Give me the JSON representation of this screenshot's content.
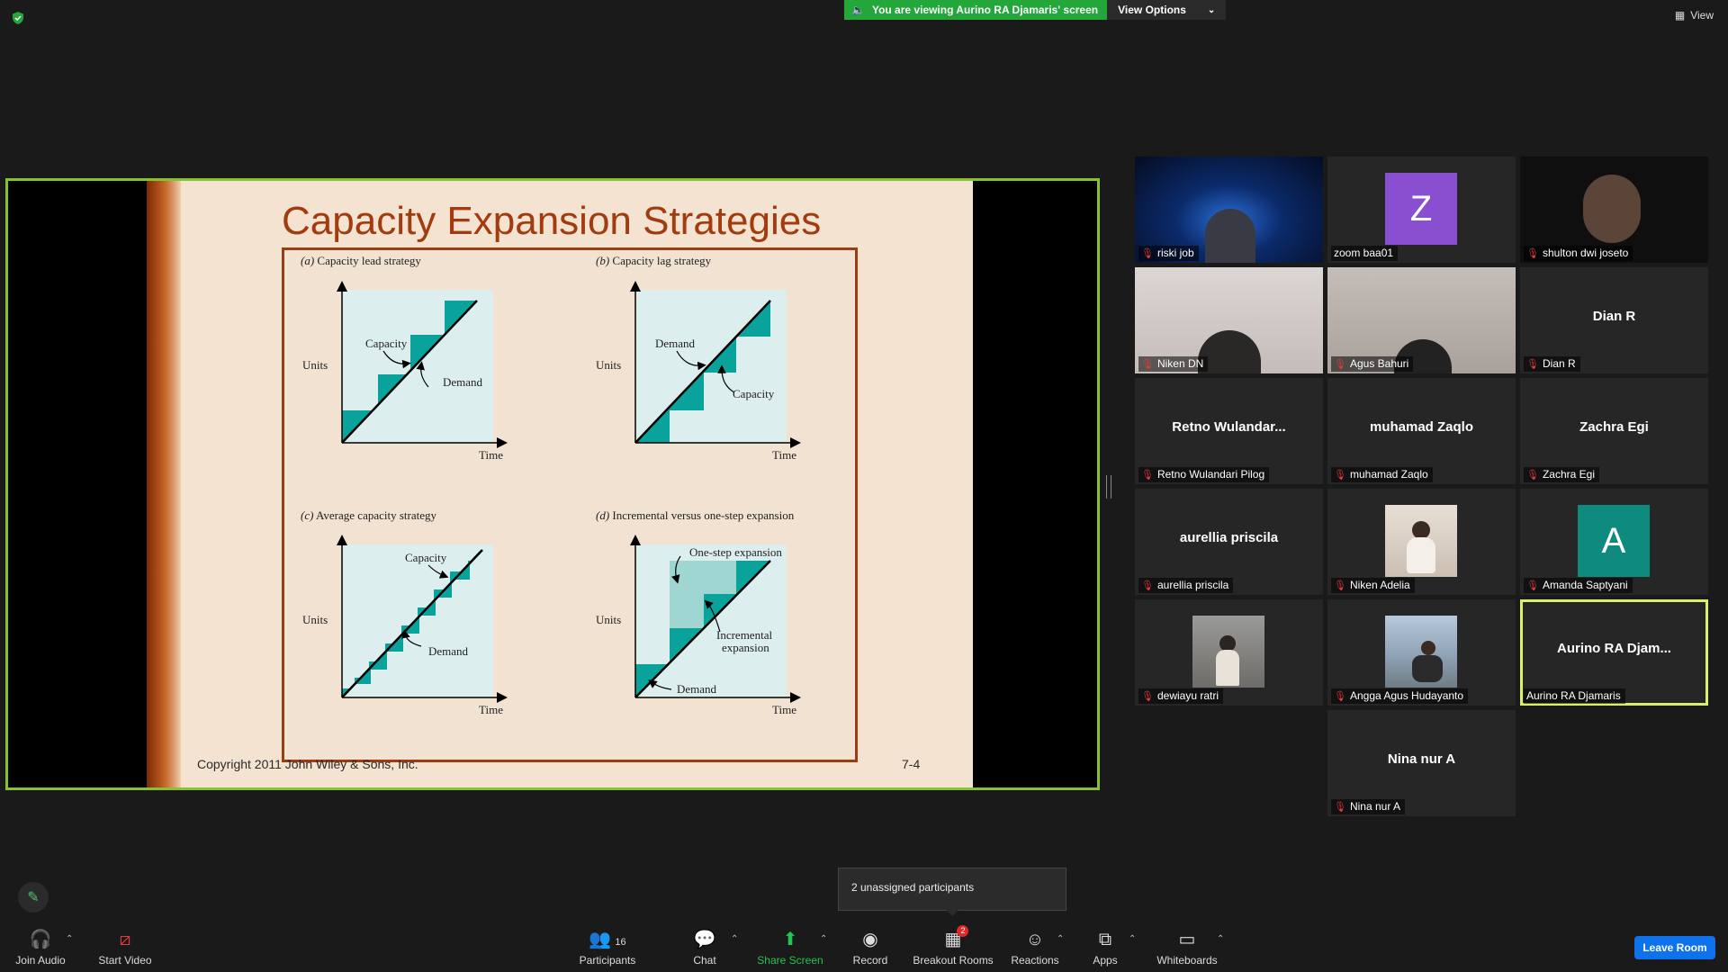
{
  "banner": {
    "viewing_text": "You are viewing Aurino RA Djamaris' screen",
    "view_options": "View Options"
  },
  "top_right": {
    "view_label": "View"
  },
  "slide": {
    "title": "Capacity Expansion Strategies",
    "panels": [
      {
        "label": "(a)",
        "title": "Capacity lead strategy",
        "y_label": "Units",
        "x_label": "Time",
        "annotations": [
          "Capacity",
          "Demand"
        ]
      },
      {
        "label": "(b)",
        "title": "Capacity lag strategy",
        "y_label": "Units",
        "x_label": "Time",
        "annotations": [
          "Demand",
          "Capacity"
        ]
      },
      {
        "label": "(c)",
        "title": "Average capacity strategy",
        "y_label": "Units",
        "x_label": "Time",
        "annotations": [
          "Capacity",
          "Demand"
        ]
      },
      {
        "label": "(d)",
        "title": "Incremental versus one-step expansion",
        "y_label": "Units",
        "x_label": "Time",
        "annotations": [
          "One-step expansion",
          "Incremental",
          "expansion",
          "Demand"
        ]
      }
    ],
    "copyright": "Copyright 2011 John Wiley & Sons, Inc.",
    "page": "7-4"
  },
  "participants": [
    {
      "name": "riski job",
      "display": "",
      "type": "video"
    },
    {
      "name": "zoom baa01",
      "display": "Z",
      "type": "avatar",
      "color": "#8a4fd0"
    },
    {
      "name": "shulton dwi joseto",
      "display": "",
      "type": "video"
    },
    {
      "name": "Niken DN",
      "display": "",
      "type": "video"
    },
    {
      "name": "Agus Bahuri",
      "display": "",
      "type": "video"
    },
    {
      "name": "Dian R",
      "display": "Dian R",
      "type": "text"
    },
    {
      "name": "Retno Wulandari Pilog",
      "display": "Retno  Wulandar...",
      "type": "text"
    },
    {
      "name": "muhamad Zaqlo",
      "display": "muhamad Zaqlo",
      "type": "text"
    },
    {
      "name": "Zachra Egi",
      "display": "Zachra Egi",
      "type": "text"
    },
    {
      "name": "aurellia priscila",
      "display": "aurellia priscila",
      "type": "text"
    },
    {
      "name": "Niken Adelia",
      "display": "",
      "type": "photo"
    },
    {
      "name": "Amanda Saptyani",
      "display": "A",
      "type": "avatar",
      "color": "#0e8a7e"
    },
    {
      "name": "dewiayu ratri",
      "display": "",
      "type": "photo"
    },
    {
      "name": "Angga Agus Hudayanto",
      "display": "",
      "type": "photo"
    },
    {
      "name": "Aurino RA Djamaris",
      "display": "Aurino  RA  Djam...",
      "type": "text"
    },
    {
      "name": "Nina nur A",
      "display": "Nina nur A",
      "type": "text"
    }
  ],
  "toolbar": {
    "join_audio": "Join Audio",
    "start_video": "Start Video",
    "participants": "Participants",
    "participants_count": "16",
    "chat": "Chat",
    "share_screen": "Share Screen",
    "record": "Record",
    "breakout_rooms": "Breakout Rooms",
    "breakout_badge": "2",
    "reactions": "Reactions",
    "apps": "Apps",
    "whiteboards": "Whiteboards",
    "leave_room": "Leave Room"
  },
  "popup": {
    "unassigned": "2 unassigned participants"
  },
  "colors": {
    "share_border": "#86c232",
    "teal": "#0aa39b",
    "banner_green": "#23a63a",
    "leave_blue": "#0e72ed"
  }
}
